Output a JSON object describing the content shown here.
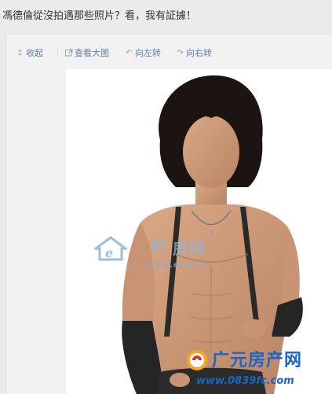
{
  "post": {
    "text": "馮德倫從沒拍遇那些照片？看，我有証據！"
  },
  "toolbar": {
    "collapse_label": "收起",
    "view_large_label": "查看大图",
    "rotate_left_label": "向左转",
    "rotate_right_label": "向右转"
  },
  "icons": {
    "collapse": "arrow-up-icon",
    "view_large": "external-link-icon",
    "rotate_left": "rotate-left-icon",
    "rotate_right": "rotate-right-icon"
  },
  "watermarks": {
    "efw": {
      "logo_e": "e",
      "name": "房网",
      "url": "www.efw.cn"
    },
    "guangyuan": {
      "name": "广元房产网",
      "url": "www.0839fc.com"
    }
  },
  "colors": {
    "link": "#5d7fa8",
    "watermark_blue": "#1a66c8",
    "page_bg": "#ebebeb",
    "panel_bg": "#f2f2f2"
  }
}
